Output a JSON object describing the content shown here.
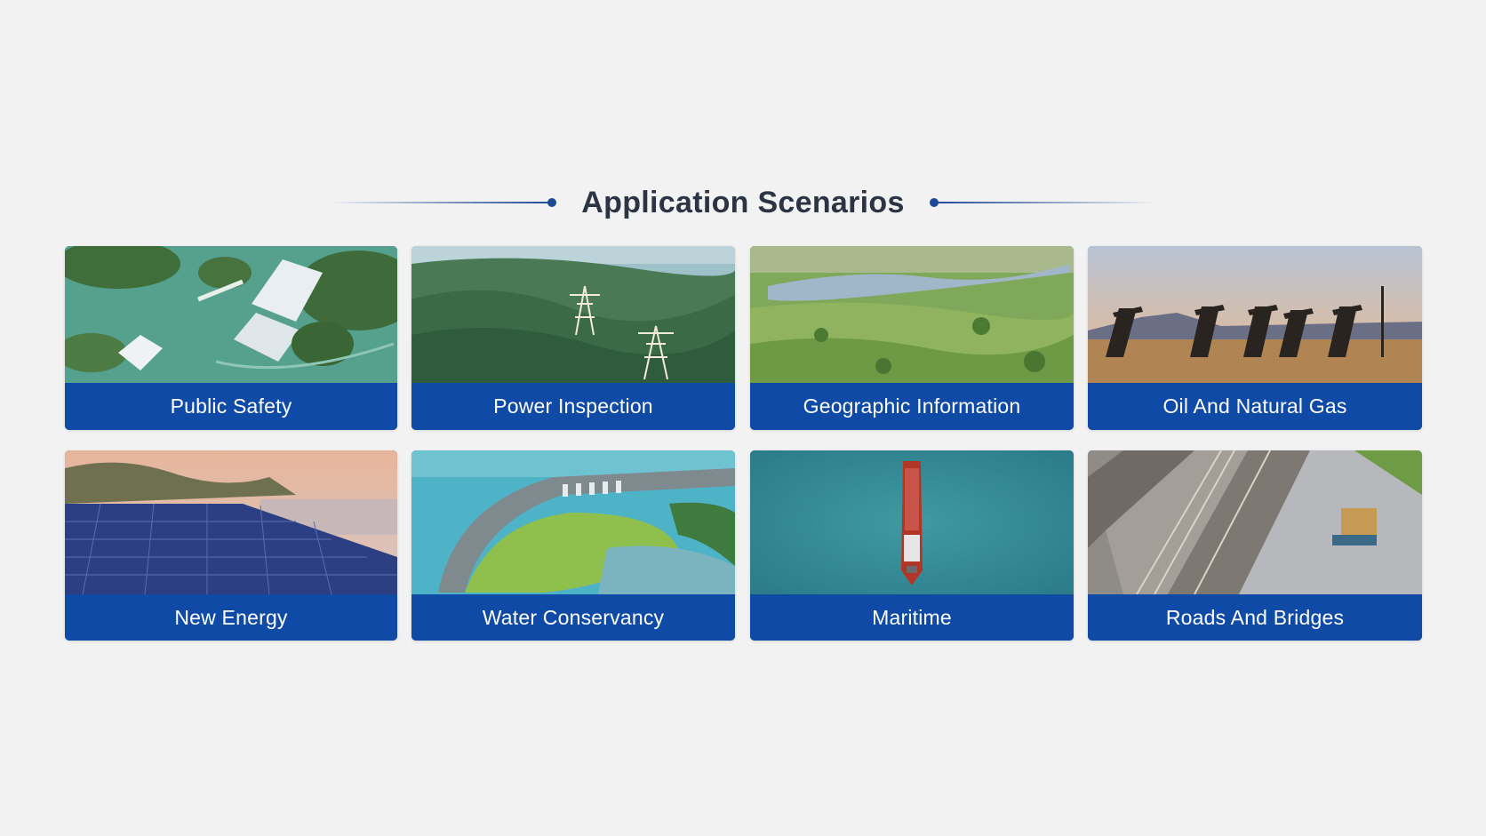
{
  "section": {
    "title": "Application Scenarios"
  },
  "scenarios": [
    {
      "label": "Public Safety",
      "icon": "flooded-town-photo"
    },
    {
      "label": "Power Inspection",
      "icon": "power-towers-photo"
    },
    {
      "label": "Geographic Information",
      "icon": "green-hills-photo"
    },
    {
      "label": "Oil And Natural Gas",
      "icon": "oil-pumpjacks-photo"
    },
    {
      "label": "New Energy",
      "icon": "solar-farm-photo"
    },
    {
      "label": "Water Conservancy",
      "icon": "dam-photo"
    },
    {
      "label": "Maritime",
      "icon": "cargo-ship-photo"
    },
    {
      "label": "Roads And Bridges",
      "icon": "highway-bridge-photo"
    }
  ],
  "colors": {
    "background": "#f2f2f2",
    "accent": "#0f4aa6",
    "title": "#2c3444"
  }
}
